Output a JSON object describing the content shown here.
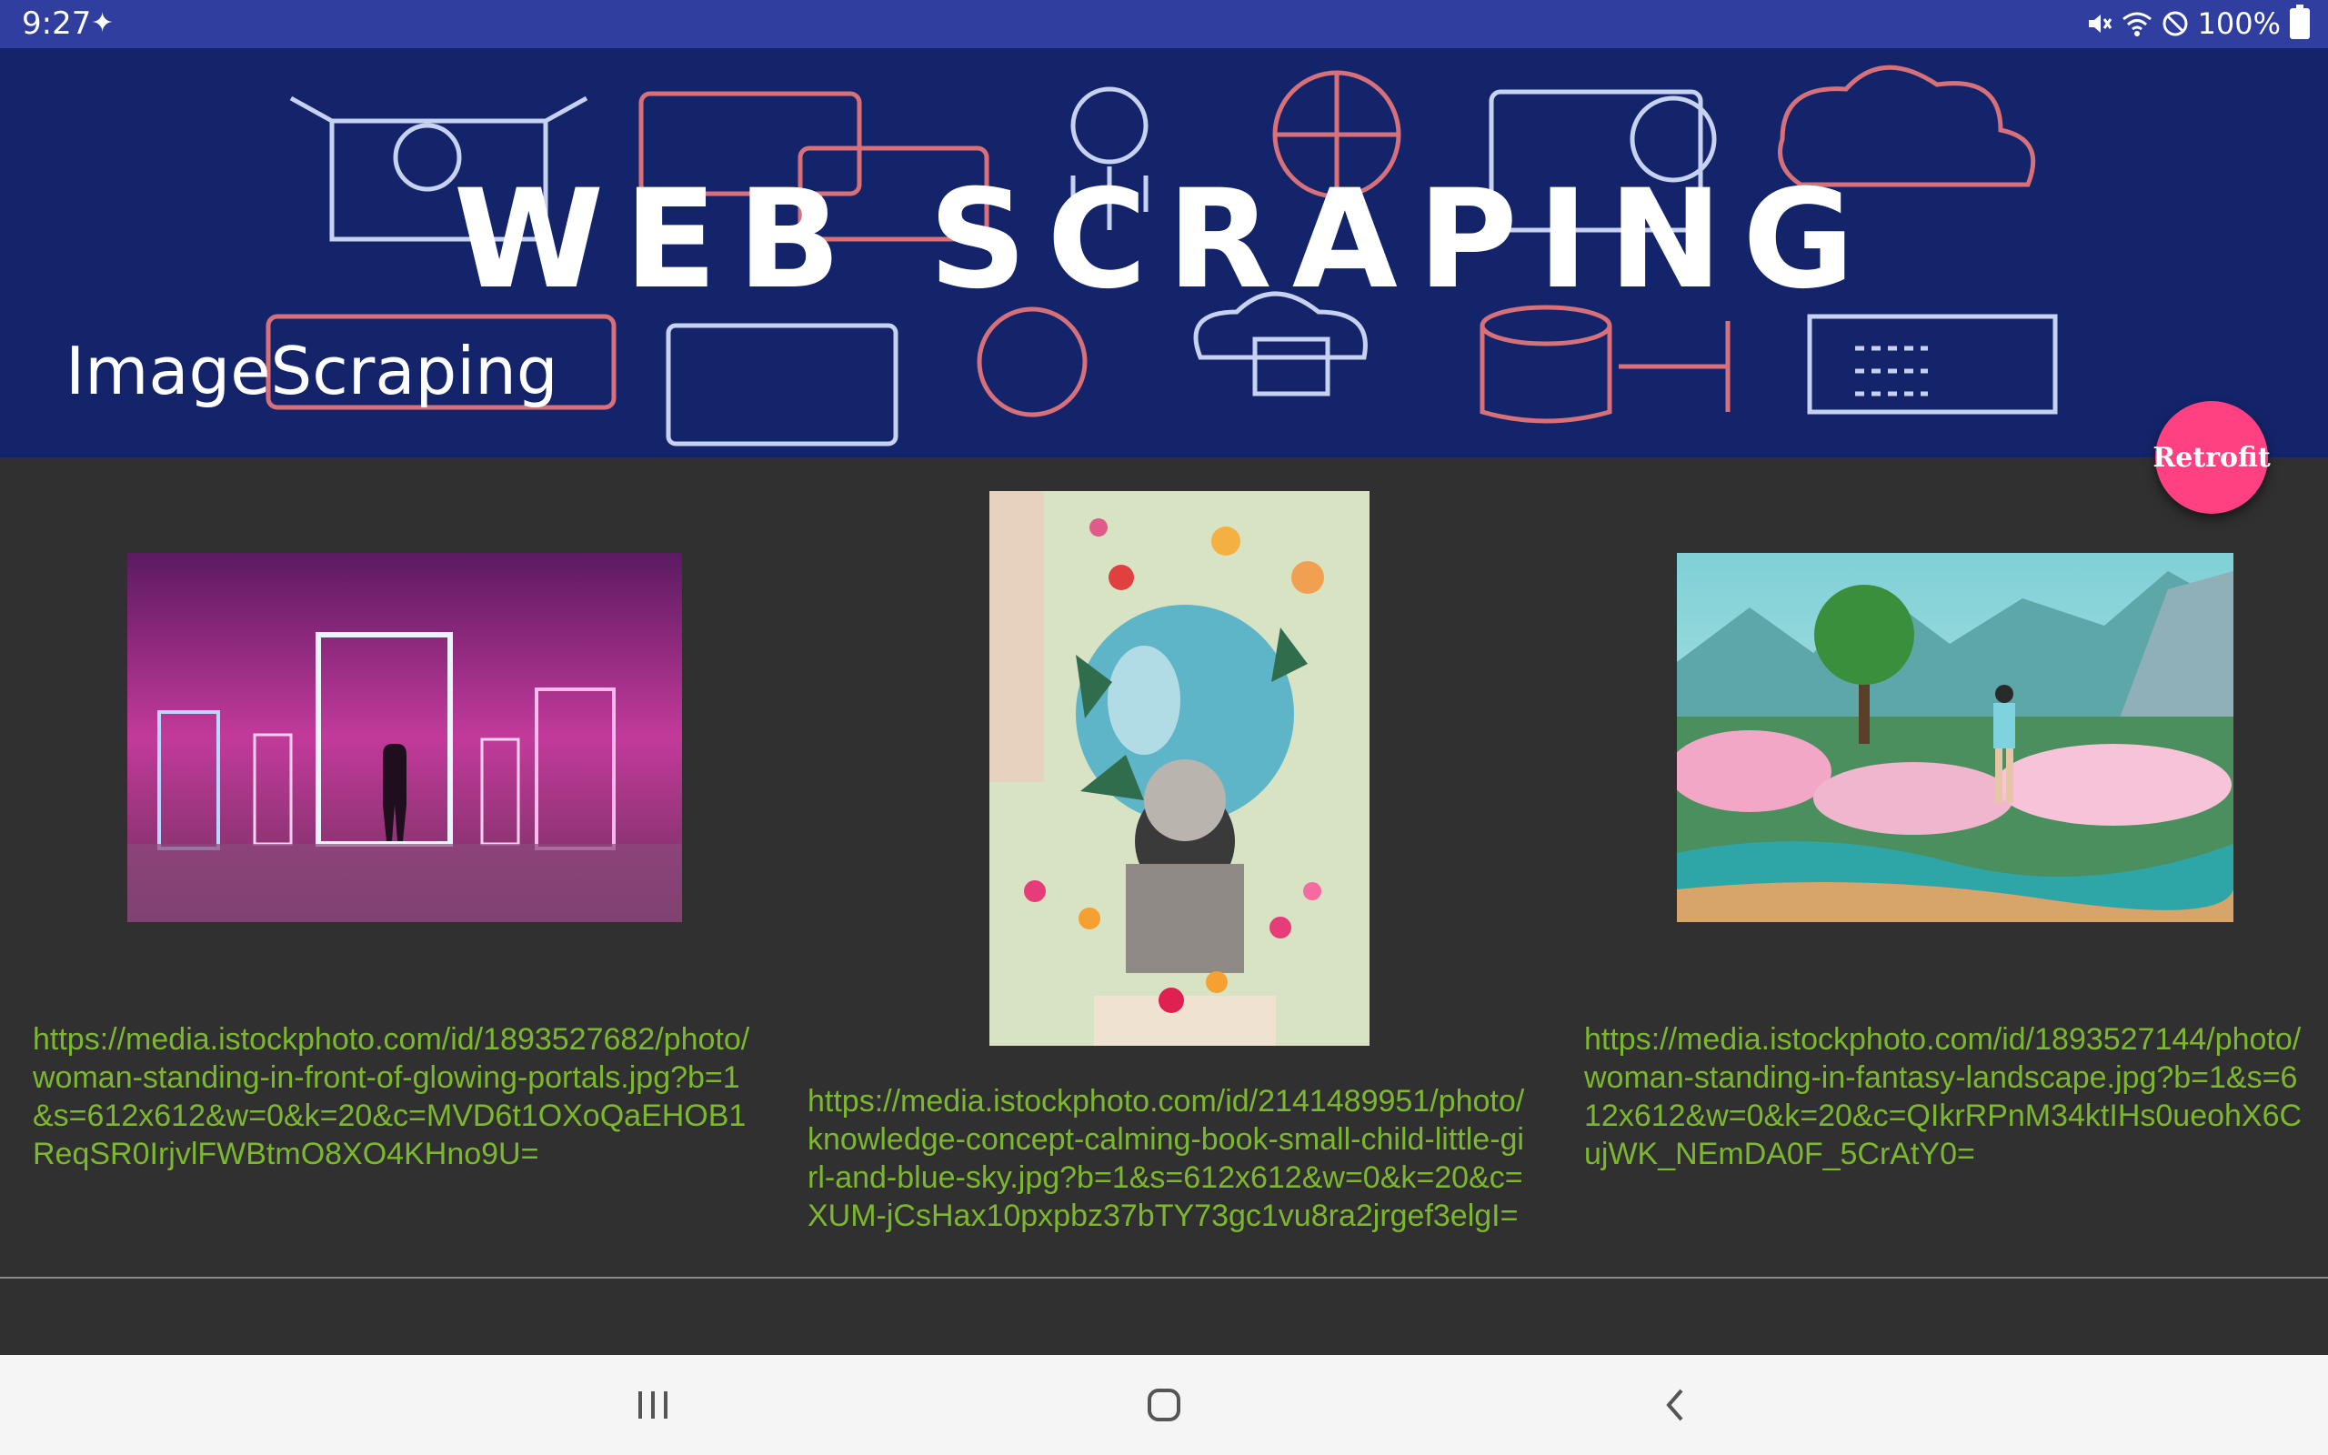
{
  "status": {
    "time": "9:27",
    "battery": "100%",
    "icons": [
      "mute-icon",
      "wifi-icon",
      "do-not-disturb-icon",
      "battery-icon"
    ]
  },
  "header": {
    "banner_text": "WEB SCRAPING",
    "title": "ImageScraping"
  },
  "fab": {
    "label": "Retrofit"
  },
  "items": [
    {
      "image": "woman-standing-in-front-of-glowing-portals",
      "url": "https://media.istockphoto.com/id/1893527682/photo/woman-standing-in-front-of-glowing-portals.jpg?b=1&s=612x612&w=0&k=20&c=MVD6t1OXoQaEHOB1ReqSR0IrjvlFWBtmO8XO4KHno9U="
    },
    {
      "image": "knowledge-concept-calming-book-small-child",
      "url": "https://media.istockphoto.com/id/2141489951/photo/knowledge-concept-calming-book-small-child-little-girl-and-blue-sky.jpg?b=1&s=612x612&w=0&k=20&c=XUM-jCsHax10pxpbz37bTY73gc1vu8ra2jrgef3elgI="
    },
    {
      "image": "woman-standing-in-fantasy-landscape",
      "url": "https://media.istockphoto.com/id/1893527144/photo/woman-standing-in-fantasy-landscape.jpg?b=1&s=612x612&w=0&k=20&c=QIkrRPnM34ktIHs0ueohX6CujWK_NEmDA0F_5CrAtY0="
    }
  ],
  "nav": {
    "recents": "recents-icon",
    "home": "home-icon",
    "back": "back-icon"
  },
  "colors": {
    "status_bar": "#303f9f",
    "fab": "#ff4081",
    "url_text": "#7cb82f",
    "background": "#303030"
  }
}
